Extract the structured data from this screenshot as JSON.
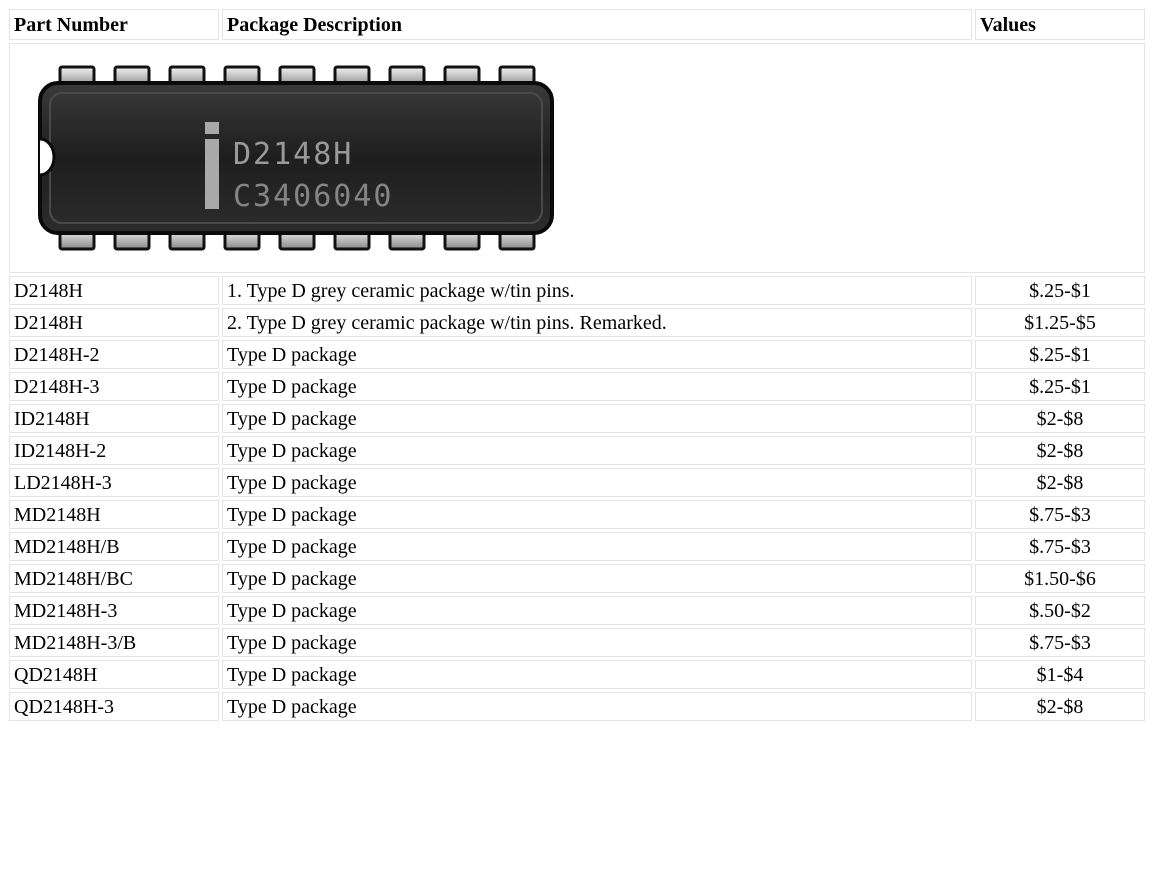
{
  "headers": {
    "part": "Part Number",
    "description": "Package Description",
    "values": "Values"
  },
  "chip_photo": {
    "line1": "D2148H",
    "line2": "C3406040",
    "logo_letter": "i"
  },
  "rows": [
    {
      "part": "D2148H",
      "description": "1.  Type D grey ceramic package w/tin pins.",
      "value": "$.25-$1"
    },
    {
      "part": "D2148H",
      "description": "2.  Type D grey ceramic package w/tin pins.  Remarked.",
      "value": "$1.25-$5"
    },
    {
      "part": "D2148H-2",
      "description": "Type D package",
      "value": "$.25-$1"
    },
    {
      "part": "D2148H-3",
      "description": "Type D package",
      "value": "$.25-$1"
    },
    {
      "part": "ID2148H",
      "description": "Type D package",
      "value": "$2-$8"
    },
    {
      "part": "ID2148H-2",
      "description": "Type D package",
      "value": "$2-$8"
    },
    {
      "part": "LD2148H-3",
      "description": "Type D package",
      "value": "$2-$8"
    },
    {
      "part": "MD2148H",
      "description": "Type D package",
      "value": "$.75-$3"
    },
    {
      "part": "MD2148H/B",
      "description": "Type D package",
      "value": "$.75-$3"
    },
    {
      "part": "MD2148H/BC",
      "description": "Type D package",
      "value": "$1.50-$6"
    },
    {
      "part": "MD2148H-3",
      "description": "Type D package",
      "value": "$.50-$2"
    },
    {
      "part": "MD2148H-3/B",
      "description": "Type D package",
      "value": "$.75-$3"
    },
    {
      "part": "QD2148H",
      "description": "Type D package",
      "value": "$1-$4"
    },
    {
      "part": "QD2148H-3",
      "description": "Type D package",
      "value": "$2-$8"
    }
  ]
}
